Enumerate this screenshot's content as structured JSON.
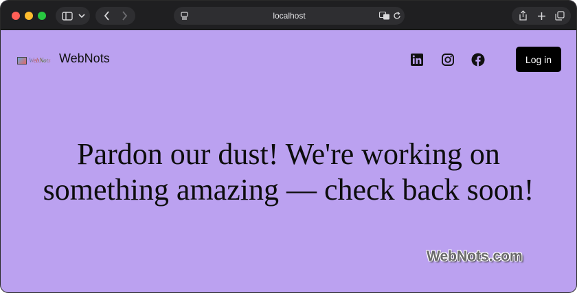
{
  "browser": {
    "address": "localhost",
    "icons": [
      "sidebar-toggle-icon",
      "chevron-down-icon",
      "back-icon",
      "forward-icon",
      "page-menu-icon",
      "translate-icon",
      "reload-icon",
      "share-icon",
      "new-tab-icon",
      "tabs-overview-icon"
    ]
  },
  "site": {
    "logo_text": "WebNots",
    "title": "WebNots",
    "login_label": "Log in",
    "social": [
      "linkedin-icon",
      "instagram-icon",
      "facebook-icon"
    ]
  },
  "main": {
    "headline": "Pardon our dust! We're working on something amazing — check back soon!"
  },
  "watermark": "WebNots.com",
  "colors": {
    "page_background": "#bba1f0",
    "chrome_background": "#1f1f21",
    "button_background": "#000000"
  }
}
